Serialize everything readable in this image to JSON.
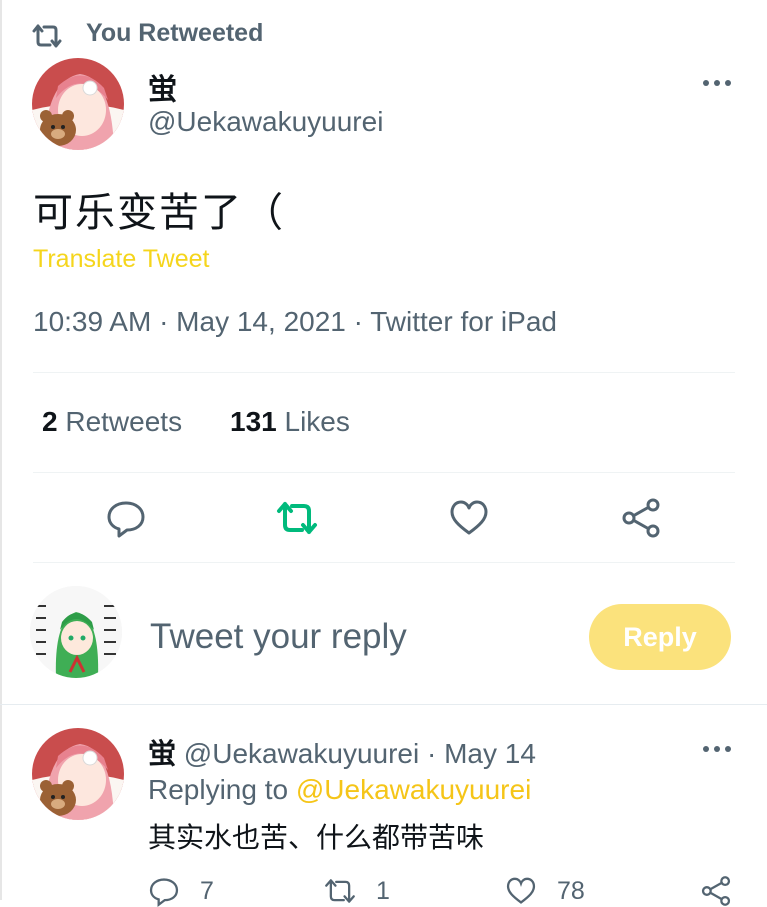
{
  "header": {
    "retweet_label": "You Retweeted"
  },
  "tweet": {
    "display_name": "蛍",
    "handle": "@Uekawakuyuurei",
    "text": "可乐变苦了（",
    "translate": "Translate Tweet",
    "meta": "10:39 AM · May 14, 2021 · Twitter for iPad"
  },
  "stats": {
    "retweets_count": "2",
    "retweets_label": "Retweets",
    "likes_count": "131",
    "likes_label": "Likes"
  },
  "actions": [
    "reply-icon",
    "retweet-icon",
    "like-icon",
    "share-icon"
  ],
  "composer": {
    "placeholder": "Tweet your reply",
    "button": "Reply"
  },
  "reply": {
    "display_name": "蛍",
    "handle": "@Uekawakuyuurei",
    "date": "· May 14",
    "replying_prefix": "Replying to",
    "replying_to": "@Uekawakuyuurei",
    "text": "其实水也苦、什么都带苦味",
    "reply_count": "7",
    "retweet_count": "1",
    "like_count": "78"
  },
  "colors": {
    "accent": "#f5d51c",
    "retweet_green": "#00ba7c",
    "muted": "#536471",
    "reply_button": "#fbe27c"
  }
}
